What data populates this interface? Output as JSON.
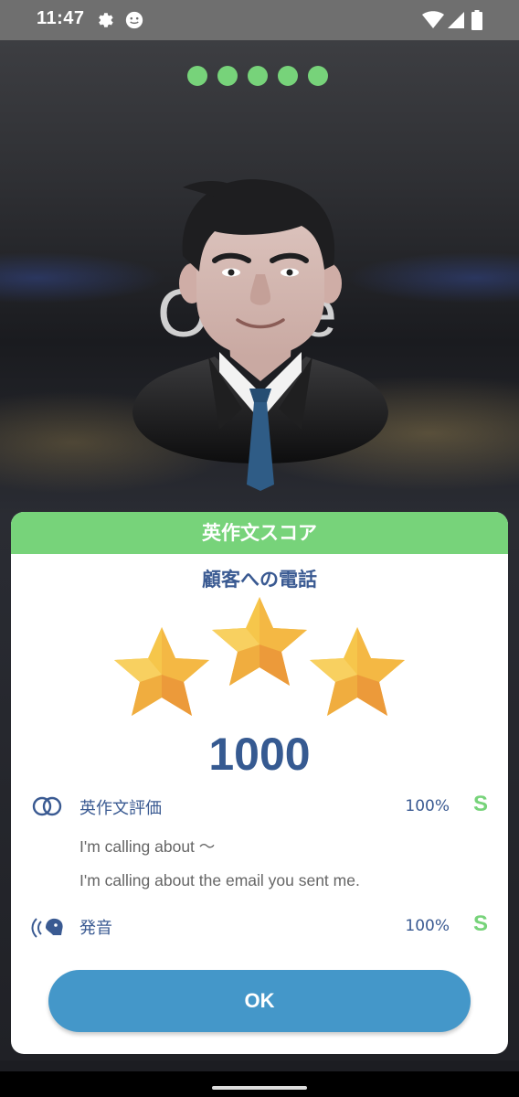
{
  "status_bar": {
    "time": "11:47",
    "icons": [
      "gear-icon",
      "smiley-icon",
      "wifi-icon",
      "signal-icon",
      "battery-icon"
    ]
  },
  "progress": {
    "total": 5,
    "completed": 5,
    "color": "#77d37a"
  },
  "background": {
    "scene_text": "Office"
  },
  "result_card": {
    "header": "英作文スコア",
    "lesson_title": "顧客への電話",
    "stars_earned": 3,
    "stars_total": 3,
    "score": "1000",
    "composition": {
      "icon": "overlapping-circles-icon",
      "label": "英作文評価",
      "percent": "100%",
      "grade": "S"
    },
    "prompt_sentence": "I'm calling about 〜",
    "answer_sentence": "I'm calling about the email you sent me.",
    "pronunciation": {
      "icon": "speaking-head-icon",
      "label": "発音",
      "percent": "100%",
      "grade": "S"
    },
    "ok_button": "OK"
  },
  "colors": {
    "accent_green": "#77d37a",
    "title_blue": "#3a5a92",
    "button_blue": "#4497c9"
  }
}
